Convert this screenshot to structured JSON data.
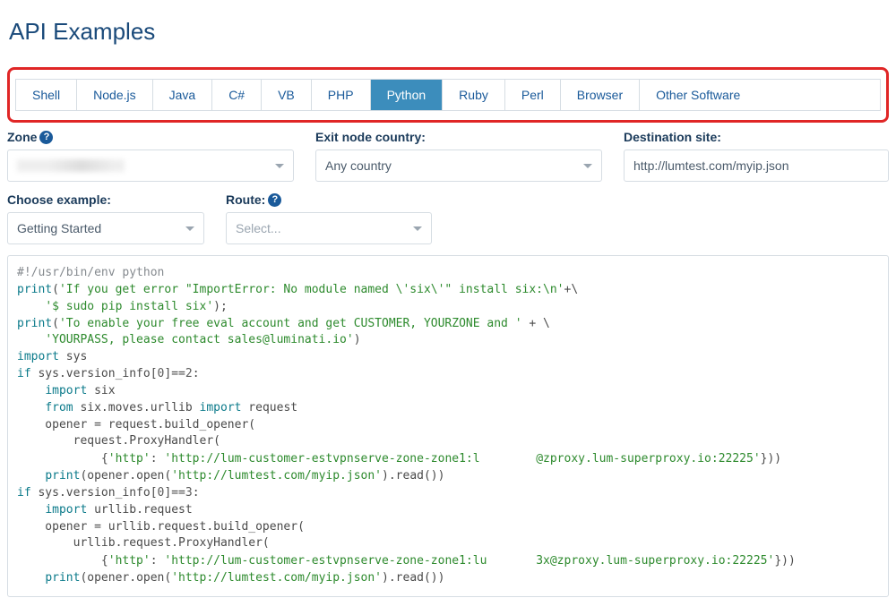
{
  "title": "API Examples",
  "tabs": [
    {
      "label": "Shell",
      "active": false
    },
    {
      "label": "Node.js",
      "active": false
    },
    {
      "label": "Java",
      "active": false
    },
    {
      "label": "C#",
      "active": false
    },
    {
      "label": "VB",
      "active": false
    },
    {
      "label": "PHP",
      "active": false
    },
    {
      "label": "Python",
      "active": true
    },
    {
      "label": "Ruby",
      "active": false
    },
    {
      "label": "Perl",
      "active": false
    },
    {
      "label": "Browser",
      "active": false
    },
    {
      "label": "Other Software",
      "active": false
    }
  ],
  "form": {
    "zone": {
      "label": "Zone",
      "value": ""
    },
    "exit_node": {
      "label": "Exit node country:",
      "value": "Any country"
    },
    "destination": {
      "label": "Destination site:",
      "value": "http://lumtest.com/myip.json"
    },
    "example": {
      "label": "Choose example:",
      "value": "Getting Started"
    },
    "route": {
      "label": "Route:",
      "placeholder": "Select..."
    }
  },
  "code": {
    "l1": "#!/usr/bin/env python",
    "l2a": "print",
    "l2b": "(",
    "l2c": "'If you get error \"ImportError: No module named \\'six\\'\" install six:\\n'",
    "l2d": "+\\",
    "l3a": "    ",
    "l3b": "'$ sudo pip install six'",
    "l3c": ");",
    "l4a": "print",
    "l4b": "(",
    "l4c": "'To enable your free eval account and get CUSTOMER, YOURZONE and '",
    "l4d": " + \\",
    "l5a": "    ",
    "l5b": "'YOURPASS, please contact sales@luminati.io'",
    "l5c": ")",
    "l6a": "import",
    "l6b": " sys",
    "l7a": "if",
    "l7b": " sys.version_info[",
    "l7c": "0",
    "l7d": "]==",
    "l7e": "2",
    "l7f": ":",
    "l8a": "    ",
    "l8b": "import",
    "l8c": " six",
    "l9a": "    ",
    "l9b": "from",
    "l9c": " six.moves.urllib ",
    "l9d": "import",
    "l9e": " request",
    "l10": "    opener = request.build_opener(",
    "l11": "        request.ProxyHandler(",
    "l12a": "            {",
    "l12b": "'http'",
    "l12c": ": ",
    "l12d": "'http://lum-customer-estvpnserve-zone-zone1:l",
    "l12e": "        ",
    "l12f": "@zproxy.lum-superproxy.io:22225'",
    "l12g": "}))",
    "l13a": "    ",
    "l13b": "print",
    "l13c": "(opener.open(",
    "l13d": "'http://lumtest.com/myip.json'",
    "l13e": ").read())",
    "l14a": "if",
    "l14b": " sys.version_info[",
    "l14c": "0",
    "l14d": "]==",
    "l14e": "3",
    "l14f": ":",
    "l15a": "    ",
    "l15b": "import",
    "l15c": " urllib.request",
    "l16": "    opener = urllib.request.build_opener(",
    "l17": "        urllib.request.ProxyHandler(",
    "l18a": "            {",
    "l18b": "'http'",
    "l18c": ": ",
    "l18d": "'http://lum-customer-estvpnserve-zone-zone1:lu",
    "l18e": "       ",
    "l18f": "3x@zproxy.lum-superproxy.io:22225'",
    "l18g": "}))",
    "l19a": "    ",
    "l19b": "print",
    "l19c": "(opener.open(",
    "l19d": "'http://lumtest.com/myip.json'",
    "l19e": ").read())"
  }
}
